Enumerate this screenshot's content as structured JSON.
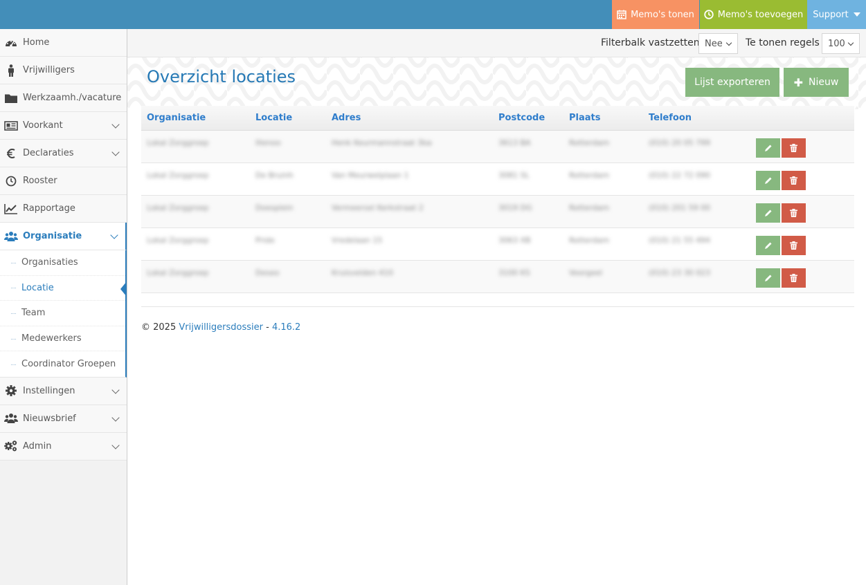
{
  "topbar": {
    "memo_show": "Memo's tonen",
    "memo_add": "Memo's toevoegen",
    "support": "Support"
  },
  "sidebar": {
    "items": [
      {
        "label": "Home",
        "icon": "dashboard-icon"
      },
      {
        "label": "Vrijwilligers",
        "icon": "person-icon"
      },
      {
        "label": "Werkzaamh./vacature",
        "icon": "folder-icon"
      },
      {
        "label": "Voorkant",
        "icon": "newspaper-icon"
      },
      {
        "label": "Declaraties",
        "icon": "euro-icon"
      },
      {
        "label": "Rooster",
        "icon": "clock-icon"
      },
      {
        "label": "Rapportage",
        "icon": "line-chart-icon"
      },
      {
        "label": "Organisatie",
        "icon": "users-icon"
      },
      {
        "label": "Instellingen",
        "icon": "gear-icon"
      },
      {
        "label": "Nieuwsbrief",
        "icon": "users-icon"
      },
      {
        "label": "Admin",
        "icon": "gears-icon"
      }
    ],
    "submenu": [
      "Organisaties",
      "Locatie",
      "Team",
      "Medewerkers",
      "Coordinator Groepen"
    ]
  },
  "filterbar": {
    "pin_label": "Filterbalk vastzetten",
    "pin_value": "Nee",
    "rows_label": "Te tonen regels",
    "rows_value": "100"
  },
  "page": {
    "title": "Overzicht locaties",
    "export_label": "Lijst exporteren",
    "new_label": "Nieuw"
  },
  "table": {
    "headers": [
      "Organisatie",
      "Locatie",
      "Adres",
      "Postcode",
      "Plaats",
      "Telefoon"
    ],
    "rows": [
      [
        "Lokal Zorggroep",
        "Illenoo",
        "Henk Keurmannstraat 3ba",
        "3613 BA",
        "Rotterdam",
        "(010) 20 05 799"
      ],
      [
        "Lokal Zorggroep",
        "De Bruinh",
        "Van Meurwelplaan 1",
        "3081 SL",
        "Rotterdam",
        "(010) 22 72 090"
      ],
      [
        "Lokal Zorggroep",
        "Doesplein",
        "Vermeersel Kerkstraat 2",
        "3019 DG",
        "Rotterdam",
        "(010) 201 59 00"
      ],
      [
        "Lokal Zorggroep",
        "Pride",
        "Vredelaan 15",
        "3063 XB",
        "Rotterdam",
        "(010) 21 55 494"
      ],
      [
        "Lokal Zorggroep",
        "Deseo",
        "Kruisvelden 410",
        "3100 KS",
        "Voorgeel",
        "(010) 23 30 023"
      ]
    ]
  },
  "footer": {
    "copyright": "© 2025",
    "brand": "Vrijwilligersdossier",
    "separator": "-",
    "version": "4.16.2"
  },
  "colors": {
    "topbar": "#438eb9",
    "memo_show": "#f79263",
    "memo_add": "#9abc32",
    "support": "#6fb3e0",
    "accent": "#2b7dbc",
    "success": "#87b87f",
    "danger": "#d15b47"
  }
}
